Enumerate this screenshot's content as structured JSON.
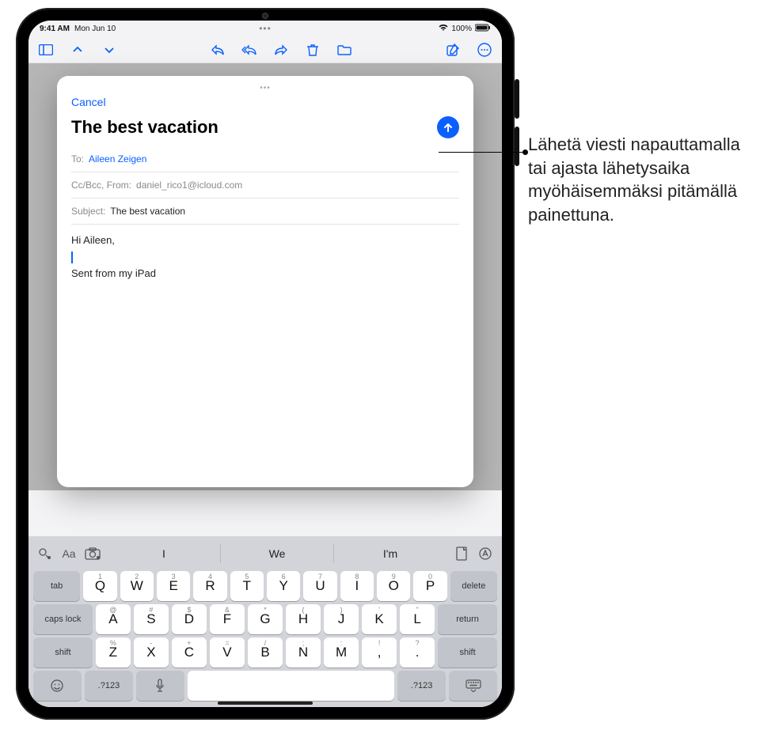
{
  "status": {
    "time": "9:41 AM",
    "date": "Mon Jun 10",
    "battery": "100%"
  },
  "compose": {
    "cancel": "Cancel",
    "title": "The best vacation",
    "to_label": "To:",
    "to_value": "Aileen Zeigen",
    "cc_label": "Cc/Bcc, From:",
    "cc_value": "daniel_rico1@icloud.com",
    "subject_label": "Subject:",
    "subject_value": "The best vacation",
    "body_greeting": "Hi Aileen,",
    "body_signature": "Sent from my iPad"
  },
  "keyboard": {
    "suggestions": [
      "I",
      "We",
      "I'm"
    ],
    "row1": [
      {
        "main": "Q",
        "alt": "1"
      },
      {
        "main": "W",
        "alt": "2"
      },
      {
        "main": "E",
        "alt": "3"
      },
      {
        "main": "R",
        "alt": "4"
      },
      {
        "main": "T",
        "alt": "5"
      },
      {
        "main": "Y",
        "alt": "6"
      },
      {
        "main": "U",
        "alt": "7"
      },
      {
        "main": "I",
        "alt": "8"
      },
      {
        "main": "O",
        "alt": "9"
      },
      {
        "main": "P",
        "alt": "0"
      }
    ],
    "row2": [
      {
        "main": "A",
        "alt": "@"
      },
      {
        "main": "S",
        "alt": "#"
      },
      {
        "main": "D",
        "alt": "$"
      },
      {
        "main": "F",
        "alt": "&"
      },
      {
        "main": "G",
        "alt": "*"
      },
      {
        "main": "H",
        "alt": "("
      },
      {
        "main": "J",
        "alt": ")"
      },
      {
        "main": "K",
        "alt": "'"
      },
      {
        "main": "L",
        "alt": "\""
      }
    ],
    "row3": [
      {
        "main": "Z",
        "alt": "%"
      },
      {
        "main": "X",
        "alt": "-"
      },
      {
        "main": "C",
        "alt": "+"
      },
      {
        "main": "V",
        "alt": "="
      },
      {
        "main": "B",
        "alt": "/"
      },
      {
        "main": "N",
        "alt": ";"
      },
      {
        "main": "M",
        "alt": ":"
      },
      {
        "main": ",",
        "alt": "!"
      },
      {
        "main": ".",
        "alt": "?"
      }
    ],
    "tab": "tab",
    "delete": "delete",
    "capslock": "caps lock",
    "return": "return",
    "shift": "shift",
    "numsym": ".?123"
  },
  "callout": {
    "text": "Lähetä viesti napauttamalla tai ajasta lähetysaika myöhäisemmäksi pitämällä painettuna."
  }
}
